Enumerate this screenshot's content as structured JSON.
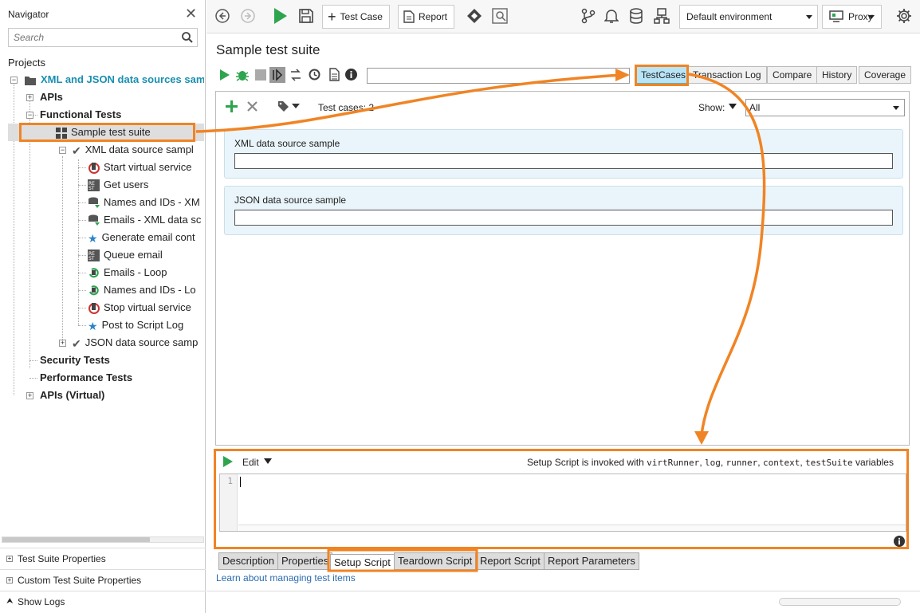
{
  "navigator": {
    "title": "Navigator",
    "search_placeholder": "Search",
    "projects_label": "Projects",
    "tree": {
      "project": "XML and JSON data sources sam",
      "apis": "APIs",
      "functional_tests": "Functional Tests",
      "suite": "Sample test suite",
      "case_xml": "XML data source sampl",
      "steps": [
        "Start virtual service",
        "Get users",
        "Names and IDs - XM",
        "Emails - XML data sc",
        "Generate email cont",
        "Queue email",
        "Emails - Loop",
        "Names and IDs - Lo",
        "Stop virtual service",
        "Post to Script Log"
      ],
      "case_json": "JSON data source samp",
      "security_tests": "Security Tests",
      "performance_tests": "Performance Tests",
      "apis_virtual": "APIs (Virtual)"
    },
    "bottom": {
      "suite_properties": "Test Suite Properties",
      "custom_properties": "Custom Test Suite Properties",
      "show_logs": "Show Logs"
    }
  },
  "toolbar": {
    "test_case": "Test Case",
    "report": "Report",
    "environment": "Default environment",
    "proxy": "Proxy"
  },
  "editor": {
    "title": "Sample test suite",
    "tabs": [
      "TestCases",
      "Transaction Log",
      "Compare",
      "History",
      "Coverage"
    ],
    "test_cases_count": "Test cases: 2",
    "show_label": "Show:",
    "show_value": "All",
    "test_cases": [
      "XML data source sample",
      "JSON data source sample"
    ],
    "script": {
      "edit_label": "Edit",
      "hint_prefix": "Setup Script is invoked with ",
      "vars": [
        "virtRunner",
        "log",
        "runner",
        "context",
        "testSuite"
      ],
      "hint_suffix": "variables",
      "line_number": "1"
    },
    "bottom_tabs": [
      "Description",
      "Properties",
      "Setup Script",
      "Teardown Script",
      "Report Script",
      "Report Parameters"
    ],
    "learn_link": "Learn about managing test items"
  },
  "colors": {
    "accent_orange": "#f08424",
    "play_green": "#2ea44f",
    "link_blue": "#2b6cb0",
    "project_teal": "#1a8fb0",
    "active_tab": "#b7e4f7"
  }
}
